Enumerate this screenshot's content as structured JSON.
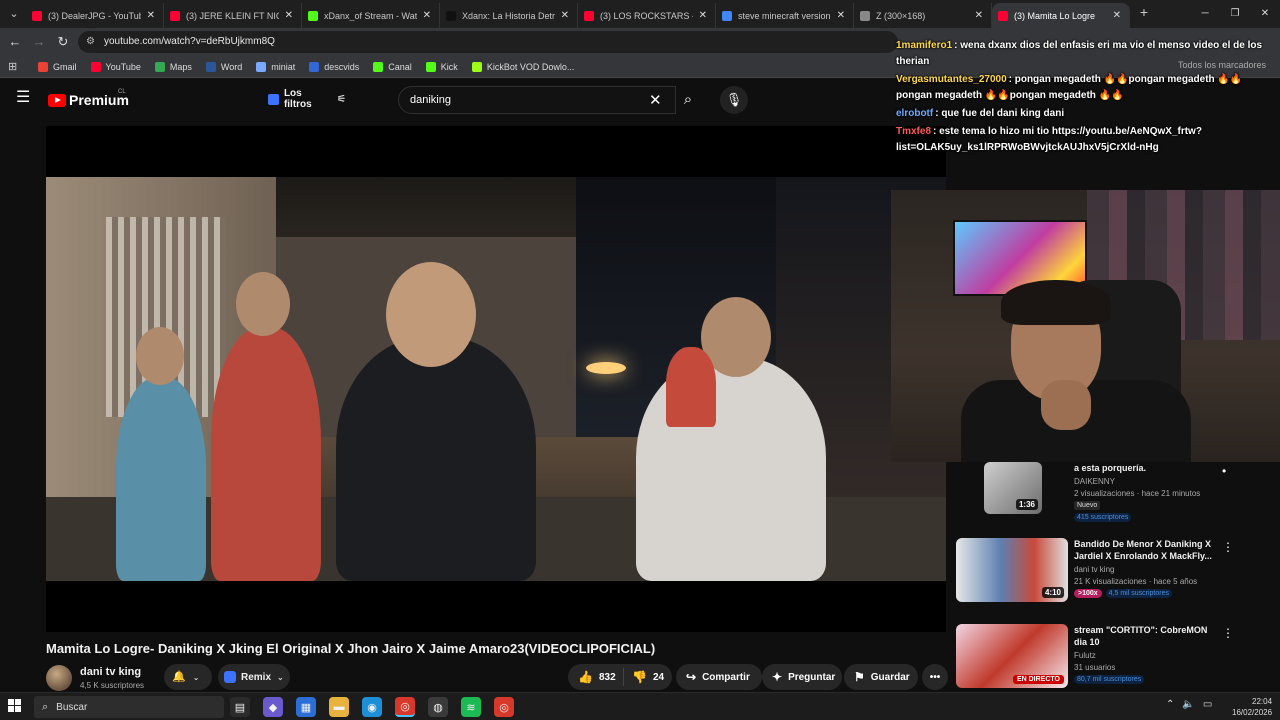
{
  "browser": {
    "tabs": [
      {
        "title": "(3) DealerJPG - YouTube",
        "icon": "youtube-favicon",
        "color": "#ff0033"
      },
      {
        "title": "(3) JERE KLEIN FT NICKOO",
        "icon": "youtube-favicon",
        "color": "#ff0033"
      },
      {
        "title": "xDanx_of Stream - Watch",
        "icon": "kick-favicon",
        "color": "#53fc18"
      },
      {
        "title": "Xdanx: La Historia Detrás",
        "icon": "tiktok-favicon",
        "color": "#111111"
      },
      {
        "title": "(3) LOS ROCKSTARS - Gal",
        "icon": "youtube-favicon",
        "color": "#ff0033"
      },
      {
        "title": "steve minecraft version re",
        "icon": "google-favicon",
        "color": "#4285f4"
      },
      {
        "title": "Z (300×168)",
        "icon": "globe-favicon",
        "color": "#888888"
      },
      {
        "title": "(3) Mamita Lo Logre",
        "icon": "youtube-favicon",
        "color": "#ff0033",
        "active": true
      }
    ],
    "url": "youtube.com/watch?v=deRbUjkmm8Q",
    "bookmarks": [
      {
        "label": "Gmail",
        "color": "#ea4335"
      },
      {
        "label": "YouTube",
        "color": "#ff0033"
      },
      {
        "label": "Maps",
        "color": "#34a853"
      },
      {
        "label": "Word",
        "color": "#2b579a"
      },
      {
        "label": "miniat",
        "color": "#7aa7ff"
      },
      {
        "label": "descvids",
        "color": "#3367d6"
      },
      {
        "label": "Canal",
        "color": "#53fc18"
      },
      {
        "label": "Kick",
        "color": "#53fc18"
      },
      {
        "label": "KickBot VOD Dowlo...",
        "color": "#9dfc18"
      }
    ],
    "all_bookmarks": "Todos los marcadores"
  },
  "youtube": {
    "brand": "Premium",
    "country": "CL",
    "filters_label": "Los filtros",
    "search_value": "daniking",
    "video": {
      "title": "Mamita Lo Logre- Daniking X Jking El Original X Jhon Jairo X Jaime Amaro23(VIDEOCLIPOFICIAL)",
      "channel": "dani tv king",
      "subscribers": "4,5 K suscriptores",
      "remix_label": "Remix",
      "likes": "832",
      "dislikes": "24",
      "share_label": "Compartir",
      "ask_label": "Preguntar",
      "save_label": "Guardar"
    },
    "suggestions": [
      {
        "title": "a esta porquería.",
        "channel": "DAIKENNY",
        "views": "2 visualizaciones · hace 21 minutos",
        "duration": "1:36",
        "badge_new": "Nuevo",
        "subs": "415 suscriptores"
      },
      {
        "title": "Bandido De Menor X Daniking X Jardiel X Enrolando X MackFly...",
        "channel": "dani tv king",
        "views": "21 K visualizaciones · hace 5 años",
        "duration": "4:10",
        "badge_pink": ">100x",
        "subs": "4,5 mil suscriptores"
      },
      {
        "title": "stream \"CORTITO\": CobreMON dia 10",
        "channel": "Fulutz",
        "views": "31 usuarios",
        "live_label": "EN DIRECTO",
        "subs": "80,7 mil suscriptores"
      }
    ]
  },
  "chat": [
    {
      "user": "1mamifero1",
      "color": "#ffd84a",
      "text": "wena dxanx dios del enfasis eri ma vio el menso video el de los therian"
    },
    {
      "user": "Vergasmutantes_27000",
      "color": "#ffd84a",
      "text": "pongan megadeth 🔥🔥pongan megadeth 🔥🔥pongan megadeth 🔥🔥pongan megadeth 🔥🔥"
    },
    {
      "user": "elrobotf",
      "color": "#6fa8ff",
      "text": "que fue del dani king dani"
    },
    {
      "user": "Tmxfe8",
      "color": "#ff5a5a",
      "text": "este tema lo hizo mi tio https://youtu.be/AeNQwX_frtw?list=OLAK5uy_ks1lRPRWoBWvjtckAUJhxV5jCrXld-nHg"
    }
  ],
  "taskbar": {
    "search_placeholder": "Buscar",
    "time": "22:04",
    "date": "16/02/2026",
    "apps": [
      {
        "icon": "task-view-icon",
        "color": "#2b2b2b",
        "glyph": "▤"
      },
      {
        "icon": "copilot-icon",
        "color": "#6a5acd",
        "glyph": "◆"
      },
      {
        "icon": "store-icon",
        "color": "#2b6fd6",
        "glyph": "▦"
      },
      {
        "icon": "file-explorer-icon",
        "color": "#e8b33c",
        "glyph": "▬"
      },
      {
        "icon": "edge-icon",
        "color": "#1e8fd6",
        "glyph": "◉"
      },
      {
        "icon": "chrome-icon",
        "color": "#d6392b",
        "glyph": "◎",
        "active": true
      },
      {
        "icon": "obs-icon",
        "color": "#3a3a3a",
        "glyph": "◍"
      },
      {
        "icon": "spotify-icon",
        "color": "#1db954",
        "glyph": "≋"
      },
      {
        "icon": "chrome-alt-icon",
        "color": "#d6392b",
        "glyph": "◎"
      }
    ]
  }
}
